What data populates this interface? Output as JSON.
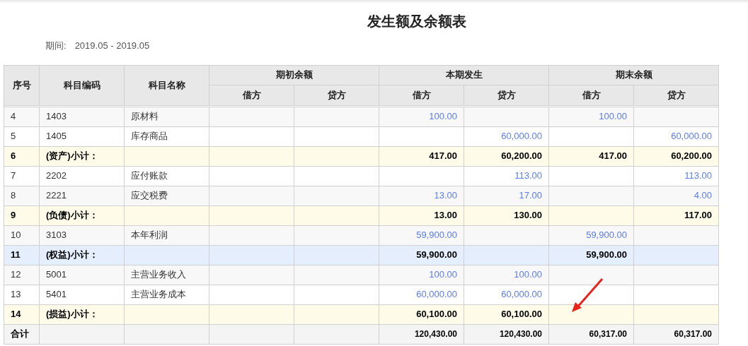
{
  "title": "发生额及余额表",
  "period": {
    "label": "期间:",
    "value": "2019.05 - 2019.05"
  },
  "table": {
    "columns": [
      "序号",
      "科目编码",
      "科目名称"
    ],
    "groups": [
      {
        "label": "期初余额",
        "sub": [
          "借方",
          "贷方"
        ]
      },
      {
        "label": "本期发生",
        "sub": [
          "借方",
          "贷方"
        ]
      },
      {
        "label": "期末余额",
        "sub": [
          "借方",
          "贷方"
        ]
      }
    ],
    "rows": [
      {
        "kind": "account",
        "selected": false,
        "no": "4",
        "code": "1403",
        "name": "原材料",
        "amounts": {
          "period_debit": "100.00",
          "closing_debit": "100.00"
        }
      },
      {
        "kind": "account",
        "selected": false,
        "no": "5",
        "code": "1405",
        "name": "库存商品",
        "amounts": {
          "period_credit": "60,000.00",
          "closing_credit": "60,000.00"
        }
      },
      {
        "kind": "subtotal",
        "selected": false,
        "no": "6",
        "code": "(资产)小计：",
        "amounts": {
          "period_debit": "417.00",
          "period_credit": "60,200.00",
          "closing_debit": "417.00",
          "closing_credit": "60,200.00"
        }
      },
      {
        "kind": "account",
        "selected": false,
        "no": "7",
        "code": "2202",
        "name": "应付账款",
        "amounts": {
          "period_credit": "113.00",
          "closing_credit": "113.00"
        }
      },
      {
        "kind": "account",
        "selected": false,
        "no": "8",
        "code": "2221",
        "name": "应交税费",
        "amounts": {
          "period_debit": "13.00",
          "period_credit": "17.00",
          "closing_credit": "4.00"
        }
      },
      {
        "kind": "subtotal",
        "selected": false,
        "no": "9",
        "code": "(负债)小计：",
        "amounts": {
          "period_debit": "13.00",
          "period_credit": "130.00",
          "closing_credit": "117.00"
        }
      },
      {
        "kind": "account",
        "selected": false,
        "no": "10",
        "code": "3103",
        "name": "本年利润",
        "amounts": {
          "period_debit": "59,900.00",
          "closing_debit": "59,900.00"
        }
      },
      {
        "kind": "subtotal",
        "selected": true,
        "no": "11",
        "code": "(权益)小计：",
        "amounts": {
          "period_debit": "59,900.00",
          "closing_debit": "59,900.00"
        }
      },
      {
        "kind": "account",
        "selected": false,
        "no": "12",
        "code": "5001",
        "name": "主营业务收入",
        "amounts": {
          "period_debit": "100.00",
          "period_credit": "100.00"
        }
      },
      {
        "kind": "account",
        "selected": false,
        "no": "13",
        "code": "5401",
        "name": "主营业务成本",
        "amounts": {
          "period_debit": "60,000.00",
          "period_credit": "60,000.00"
        }
      },
      {
        "kind": "subtotal",
        "selected": false,
        "no": "14",
        "code": "(损益)小计：",
        "amounts": {
          "period_debit": "60,100.00",
          "period_credit": "60,100.00"
        }
      }
    ],
    "total": {
      "label": "合计",
      "amounts": {
        "period_debit": "120,430.00",
        "period_credit": "120,430.00",
        "closing_debit": "60,317.00",
        "closing_credit": "60,317.00"
      }
    }
  }
}
